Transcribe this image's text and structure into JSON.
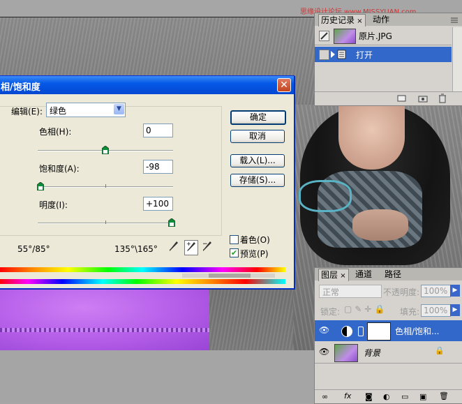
{
  "watermark": "思缘设计论坛 www.MISSYUAN.com",
  "dialog": {
    "title": "相/饱和度",
    "edit_label": "编辑(E):",
    "edit_value": "绿色",
    "hue_label": "色相(H):",
    "hue_value": "0",
    "hue_level": 0.5,
    "saturation_label": "饱和度(A):",
    "saturation_value": "-98",
    "saturation_level": 0.01,
    "lightness_label": "明度(I):",
    "lightness_value": "+100",
    "lightness_level": 1.0,
    "range_left": "55°/85°",
    "range_right": "135°\\165°",
    "ok_label": "确定",
    "cancel_label": "取消",
    "load_label": "载入(L)...",
    "save_label": "存储(S)...",
    "colorize_label": "着色(O)",
    "colorize_checked": false,
    "preview_label": "预览(P)",
    "preview_checked": true
  },
  "history_panel": {
    "tabs": [
      "历史记录",
      "动作"
    ],
    "snapshot_label": "原片.JPG",
    "items": [
      {
        "label": "打开",
        "selected": true
      }
    ]
  },
  "layers_panel": {
    "tabs": [
      "图层",
      "通道",
      "路径"
    ],
    "blend_mode": "正常",
    "opacity_label": "不透明度:",
    "opacity_value": "100%",
    "lock_label": "锁定:",
    "fill_label": "填充:",
    "fill_value": "100%",
    "layers": [
      {
        "name": "色相/饱和...",
        "selected": true
      },
      {
        "name": "背景",
        "selected": false
      }
    ]
  },
  "colors": {
    "selection": "#3268c9",
    "title_blue": "#0559e7"
  }
}
